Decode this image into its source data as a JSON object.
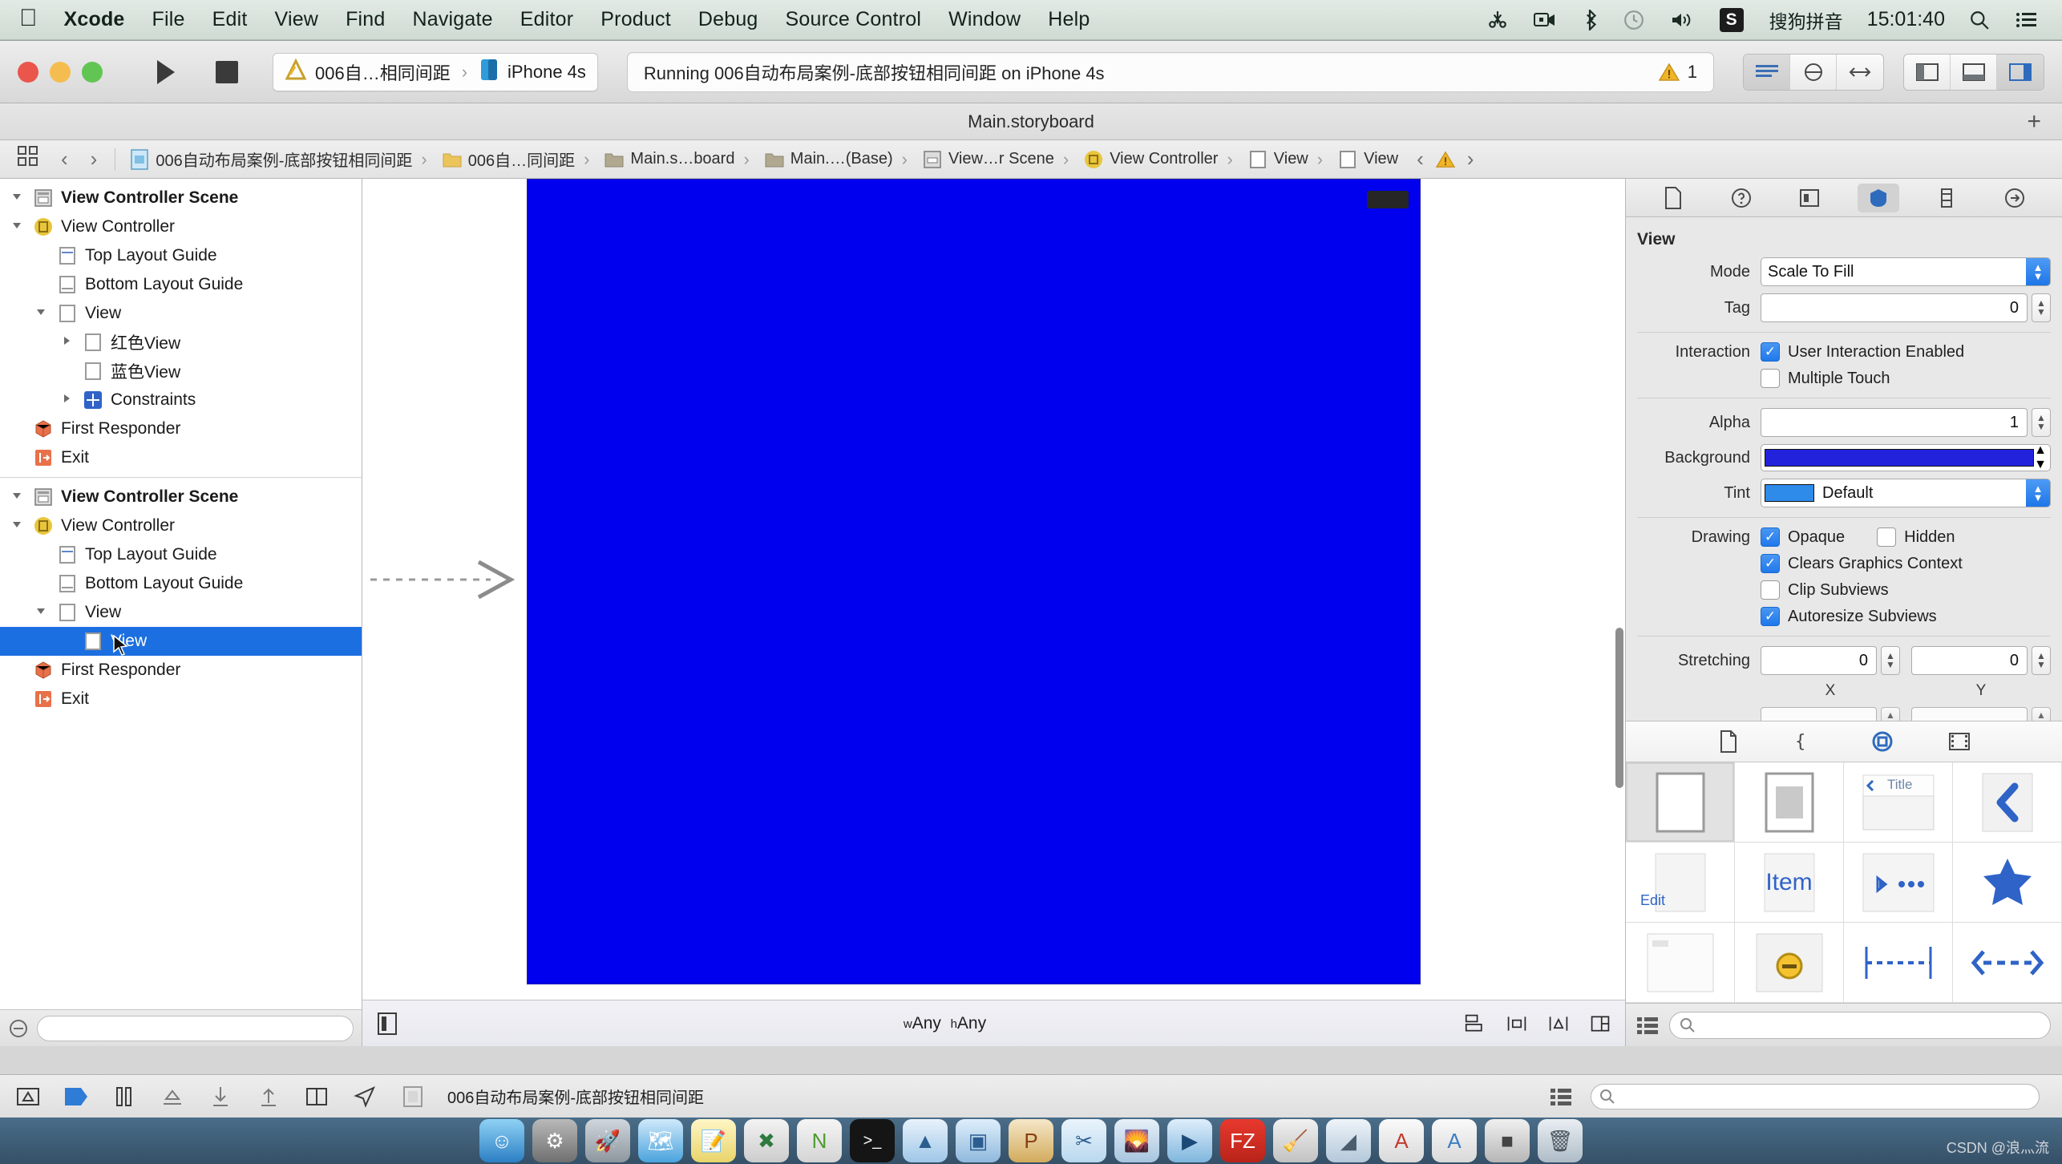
{
  "menubar": {
    "apple": "apple-logo",
    "items": [
      {
        "label": "Xcode",
        "bold": true
      },
      {
        "label": "File",
        "bold": false
      },
      {
        "label": "Edit",
        "bold": false
      },
      {
        "label": "View",
        "bold": false
      },
      {
        "label": "Find",
        "bold": false
      },
      {
        "label": "Navigate",
        "bold": false
      },
      {
        "label": "Editor",
        "bold": false
      },
      {
        "label": "Product",
        "bold": false
      },
      {
        "label": "Debug",
        "bold": false
      },
      {
        "label": "Source Control",
        "bold": false
      },
      {
        "label": "Window",
        "bold": false
      },
      {
        "label": "Help",
        "bold": false
      }
    ],
    "status": {
      "input_method": "搜狗拼音",
      "input_badge": "S",
      "clock": "15:01:40"
    }
  },
  "toolbar": {
    "run_label": "Run",
    "stop_label": "Stop",
    "scheme_project": "006自…相同间距",
    "scheme_separator": "›",
    "scheme_device": "iPhone 4s",
    "status_text": "Running 006自动布局案例-底部按钮相同间距 on iPhone 4s",
    "warning_count": "1"
  },
  "titlestrip": {
    "title": "Main.storyboard",
    "add_label": "+"
  },
  "breadcrumb": {
    "items": [
      {
        "label": "006自动布局案例-底部按钮相同间距",
        "icon": "storyboard-file-icon"
      },
      {
        "label": "006自…同间距",
        "icon": "folder-icon"
      },
      {
        "label": "Main.s…board",
        "icon": "folder-icon"
      },
      {
        "label": "Main.…(Base)",
        "icon": "folder-icon"
      },
      {
        "label": "View…r Scene",
        "icon": "scene-icon"
      },
      {
        "label": "View Controller",
        "icon": "view-controller-icon"
      },
      {
        "label": "View",
        "icon": "view-icon"
      },
      {
        "label": "View",
        "icon": "view-icon"
      }
    ]
  },
  "navigator": {
    "scenes": [
      {
        "rows": [
          {
            "label": "View Controller Scene",
            "indent": 0,
            "twisty": "down",
            "icon": "scene-icon",
            "bold": true,
            "selected": false
          },
          {
            "label": "View Controller",
            "indent": 1,
            "twisty": "down",
            "icon": "view-controller-icon",
            "bold": false,
            "selected": false
          },
          {
            "label": "Top Layout Guide",
            "indent": 2,
            "twisty": "none",
            "icon": "top-guide-icon",
            "bold": false,
            "selected": false
          },
          {
            "label": "Bottom Layout Guide",
            "indent": 2,
            "twisty": "none",
            "icon": "bottom-guide-icon",
            "bold": false,
            "selected": false
          },
          {
            "label": "View",
            "indent": 2,
            "twisty": "down",
            "icon": "view-icon",
            "bold": false,
            "selected": false
          },
          {
            "label": "红色View",
            "indent": 3,
            "twisty": "right",
            "icon": "view-icon",
            "bold": false,
            "selected": false
          },
          {
            "label": "蓝色View",
            "indent": 3,
            "twisty": "none",
            "icon": "view-icon",
            "bold": false,
            "selected": false
          },
          {
            "label": "Constraints",
            "indent": 3,
            "twisty": "right",
            "icon": "constraints-icon",
            "bold": false,
            "selected": false
          },
          {
            "label": "First Responder",
            "indent": 1,
            "twisty": "none",
            "icon": "first-responder-icon",
            "bold": false,
            "selected": false
          },
          {
            "label": "Exit",
            "indent": 1,
            "twisty": "none",
            "icon": "exit-icon",
            "bold": false,
            "selected": false
          }
        ]
      },
      {
        "rows": [
          {
            "label": "View Controller Scene",
            "indent": 0,
            "twisty": "down",
            "icon": "scene-icon",
            "bold": true,
            "selected": false
          },
          {
            "label": "View Controller",
            "indent": 1,
            "twisty": "down",
            "icon": "view-controller-icon",
            "bold": false,
            "selected": false
          },
          {
            "label": "Top Layout Guide",
            "indent": 2,
            "twisty": "none",
            "icon": "top-guide-icon",
            "bold": false,
            "selected": false
          },
          {
            "label": "Bottom Layout Guide",
            "indent": 2,
            "twisty": "none",
            "icon": "bottom-guide-icon",
            "bold": false,
            "selected": false
          },
          {
            "label": "View",
            "indent": 2,
            "twisty": "down",
            "icon": "view-icon",
            "bold": false,
            "selected": false
          },
          {
            "label": "View",
            "indent": 3,
            "twisty": "none",
            "icon": "view-icon",
            "bold": false,
            "selected": true
          },
          {
            "label": "First Responder",
            "indent": 1,
            "twisty": "none",
            "icon": "first-responder-icon",
            "bold": false,
            "selected": false
          },
          {
            "label": "Exit",
            "indent": 1,
            "twisty": "none",
            "icon": "exit-icon",
            "bold": false,
            "selected": false
          }
        ]
      }
    ],
    "filter_placeholder": ""
  },
  "canvas": {
    "view_background_color": "#0000EE",
    "size_class": {
      "w_prefix": "w",
      "w_value": "Any",
      "h_prefix": "h",
      "h_value": "Any"
    }
  },
  "inspector": {
    "section_title": "View",
    "mode": {
      "label": "Mode",
      "value": "Scale To Fill"
    },
    "tag": {
      "label": "Tag",
      "value": "0"
    },
    "interaction": {
      "label": "Interaction",
      "user_interaction": {
        "label": "User Interaction Enabled",
        "checked": true
      },
      "multiple_touch": {
        "label": "Multiple Touch",
        "checked": false
      }
    },
    "alpha": {
      "label": "Alpha",
      "value": "1"
    },
    "background": {
      "label": "Background",
      "color": "#2222DD"
    },
    "tint": {
      "label": "Tint",
      "value": "Default",
      "color": "#2e8bea"
    },
    "drawing": {
      "label": "Drawing",
      "opaque": {
        "label": "Opaque",
        "checked": true
      },
      "hidden": {
        "label": "Hidden",
        "checked": false
      },
      "clears_graphics_context": {
        "label": "Clears Graphics Context",
        "checked": true
      },
      "clip_subviews": {
        "label": "Clip Subviews",
        "checked": false
      },
      "autoresize_subviews": {
        "label": "Autoresize Subviews",
        "checked": true
      }
    },
    "stretching": {
      "label": "Stretching",
      "x_value": "0",
      "y_value": "0",
      "x_caption": "X",
      "y_caption": "Y"
    }
  },
  "library": {
    "tabs": [
      "file-template-icon",
      "code-snippet-icon",
      "object-library-icon",
      "media-library-icon"
    ],
    "items": [
      {
        "name": "view-object",
        "label": ""
      },
      {
        "name": "container-view-object",
        "label": ""
      },
      {
        "name": "navigation-bar-object",
        "label": "Title"
      },
      {
        "name": "navigation-item-back-object",
        "label": ""
      },
      {
        "name": "bar-button-item-object",
        "label": "Edit"
      },
      {
        "name": "fixed-space-bar-item-object",
        "label": "Item"
      },
      {
        "name": "toolbar-object",
        "label": ""
      },
      {
        "name": "tab-bar-item-object",
        "label": ""
      },
      {
        "name": "table-view-cell-object",
        "label": ""
      },
      {
        "name": "tab-bar-object",
        "label": ""
      },
      {
        "name": "vertical-spacing-constraint",
        "label": ""
      },
      {
        "name": "horizontal-spacing-constraint",
        "label": ""
      }
    ],
    "search_placeholder": ""
  },
  "debugbar": {
    "scheme_label": "006自动布局案例-底部按钮相同间距"
  },
  "desktop": {
    "watermark": "CSDN @浪灬流"
  }
}
